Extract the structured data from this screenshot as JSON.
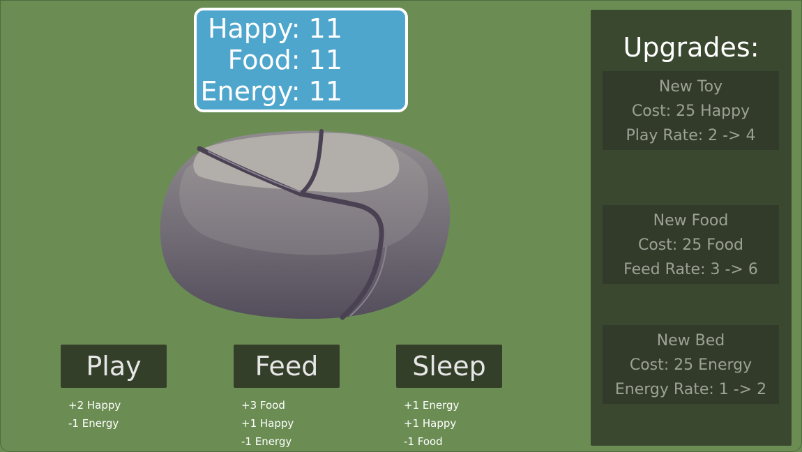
{
  "stats": {
    "happy": "Happy: 11",
    "food": "Food: 11",
    "energy": "Energy: 11"
  },
  "pet": {
    "icon": "rock-pet-icon"
  },
  "actions": [
    {
      "label": "Play",
      "effects": [
        "+2 Happy",
        "-1 Energy"
      ]
    },
    {
      "label": "Feed",
      "effects": [
        "+3 Food",
        "+1 Happy",
        "-1 Energy"
      ]
    },
    {
      "label": "Sleep",
      "effects": [
        "+1 Energy",
        "+1 Happy",
        "-1 Food"
      ]
    }
  ],
  "upgrades": {
    "title": "Upgrades:",
    "items": [
      {
        "name": "New Toy",
        "cost": "Cost: 25 Happy",
        "rate": "Play Rate: 2 -> 4"
      },
      {
        "name": "New Food",
        "cost": "Cost: 25 Food",
        "rate": "Feed Rate: 3 -> 6"
      },
      {
        "name": "New Bed",
        "cost": "Cost: 25 Energy",
        "rate": "Energy Rate: 1 -> 2"
      }
    ]
  },
  "colors": {
    "background": "#6b8d54",
    "stats_box": "#4fa6cd",
    "button": "#343f2a",
    "panel": "#3b4830",
    "upgrade_card": "#323b29"
  }
}
